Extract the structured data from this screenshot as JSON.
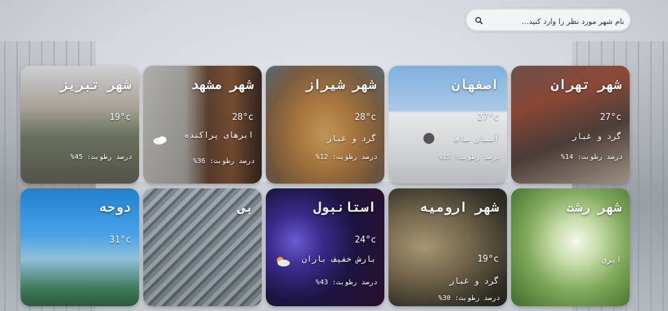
{
  "search": {
    "placeholder": "نام شهر مورد نظر را وارد کنید..."
  },
  "cards": [
    {
      "city": "شهر تهران",
      "temp": "27°c",
      "condition": "گرد و غبار",
      "humidity": "درصد رطوبت: 14%"
    },
    {
      "city": "اصفهان",
      "temp": "27°c",
      "condition": "آسمان صاف",
      "humidity": "درصد رطوبت: 15%"
    },
    {
      "city": "شهر شیراز",
      "temp": "28°c",
      "condition": "گرد و غبار",
      "humidity": "درصد رطوبت: 12%"
    },
    {
      "city": "شهر مشهد",
      "temp": "28°c",
      "condition": "ابرهای پراکنده",
      "humidity": "درصد رطوبت: 36%"
    },
    {
      "city": "شهر تبریز",
      "temp": "19°c",
      "condition": "",
      "humidity": "درصد رطوبت: 45%"
    },
    {
      "city": "شهر رشت",
      "temp": "",
      "condition": "ابری",
      "humidity": ""
    },
    {
      "city": "شهر ارومیه",
      "temp": "19°c",
      "condition": "گرد و غبار",
      "humidity": "درصد رطوبت: 30%"
    },
    {
      "city": "استانبول",
      "temp": "24°c",
      "condition": "بارش خفیف باران",
      "humidity": "درصد رطوبت: 43%"
    },
    {
      "city": "بی",
      "temp": "",
      "condition": "",
      "humidity": ""
    },
    {
      "city": "دوحه",
      "temp": "31°c",
      "condition": "",
      "humidity": ""
    }
  ],
  "colors": {
    "accent": "#ffffff",
    "search_bg": "#f3f4f6"
  }
}
